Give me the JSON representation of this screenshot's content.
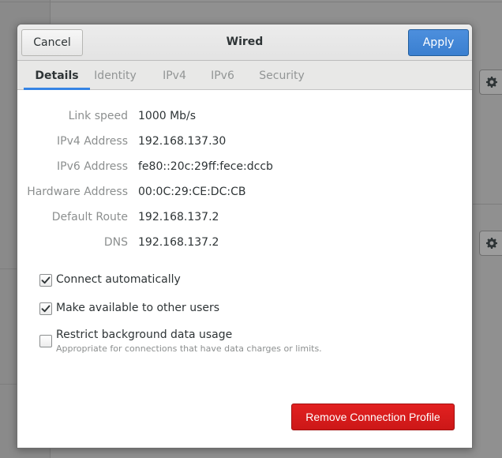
{
  "dialog": {
    "title": "Wired",
    "cancel_label": "Cancel",
    "apply_label": "Apply"
  },
  "tabs": [
    {
      "label": "Details",
      "active": true
    },
    {
      "label": "Identity",
      "active": false
    },
    {
      "label": "IPv4",
      "active": false
    },
    {
      "label": "IPv6",
      "active": false
    },
    {
      "label": "Security",
      "active": false
    }
  ],
  "details": [
    {
      "label": "Link speed",
      "value": "1000 Mb/s"
    },
    {
      "label": "IPv4 Address",
      "value": "192.168.137.30"
    },
    {
      "label": "IPv6 Address",
      "value": "fe80::20c:29ff:fece:dccb"
    },
    {
      "label": "Hardware Address",
      "value": "00:0C:29:CE:DC:CB"
    },
    {
      "label": "Default Route",
      "value": "192.168.137.2"
    },
    {
      "label": "DNS",
      "value": "192.168.137.2"
    }
  ],
  "options": {
    "connect_auto": {
      "label": "Connect automatically",
      "checked": true
    },
    "available_users": {
      "label": "Make available to other users",
      "checked": true
    },
    "restrict_bg": {
      "label": "Restrict background data usage",
      "sublabel": "Appropriate for connections that have data charges or limits.",
      "checked": false
    }
  },
  "remove_label": "Remove Connection Profile",
  "colors": {
    "accent": "#3584e4",
    "apply": "#3a7fd0",
    "destructive": "#cc1717"
  }
}
